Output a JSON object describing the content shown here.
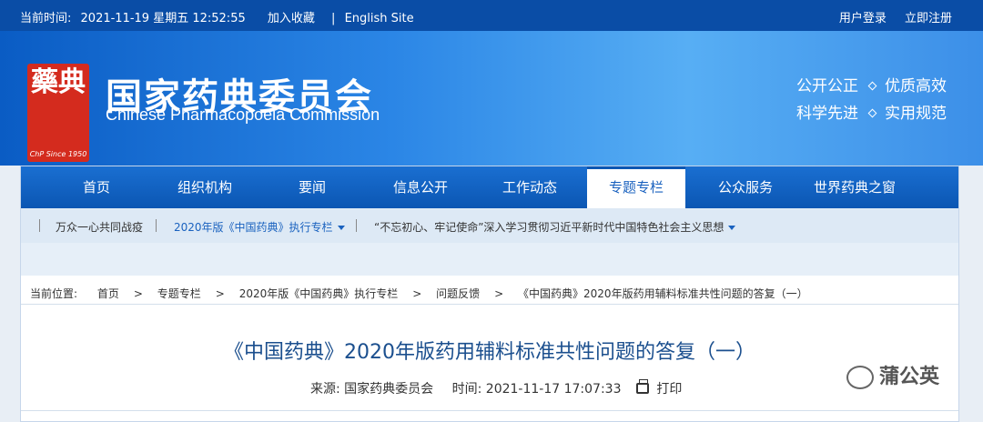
{
  "topbar": {
    "time_label": "当前时间:",
    "datetime": "2021-11-19 星期五 12:52:55",
    "favorite": "加入收藏",
    "divider": "|",
    "english": "English Site",
    "login": "用户登录",
    "register": "立即注册"
  },
  "brand": {
    "seal_glyph": "藥典",
    "seal_since": "ChP Since 1950",
    "name_cn": "国家药典委员会",
    "name_en": "Chinese Pharmacopoeia Commission"
  },
  "slogans": [
    "公开公正",
    "优质高效",
    "科学先进",
    "实用规范"
  ],
  "nav": {
    "items": [
      "首页",
      "组织机构",
      "要闻",
      "信息公开",
      "工作动态",
      "专题专栏",
      "公众服务",
      "世界药典之窗"
    ],
    "active": "专题专栏"
  },
  "subnav": {
    "items": [
      "万众一心共同战疫",
      "2020年版《中国药典》执行专栏",
      "“不忘初心、牢记使命”深入学习贯彻习近平新时代中国特色社会主义思想"
    ]
  },
  "breadcrumb": {
    "label": "当前位置:",
    "items": [
      "首页",
      "专题专栏",
      "2020年版《中国药典》执行专栏",
      "问题反馈",
      "《中国药典》2020年版药用辅料标准共性问题的答复（一）"
    ],
    "sep": ">"
  },
  "article": {
    "title": "《中国药典》2020年版药用辅料标准共性问题的答复（一）",
    "source_label": "来源:",
    "source": "国家药典委员会",
    "time_label": "时间:",
    "time": "2021-11-17 17:07:33",
    "print": "打印"
  },
  "watermark": "蒲公英"
}
